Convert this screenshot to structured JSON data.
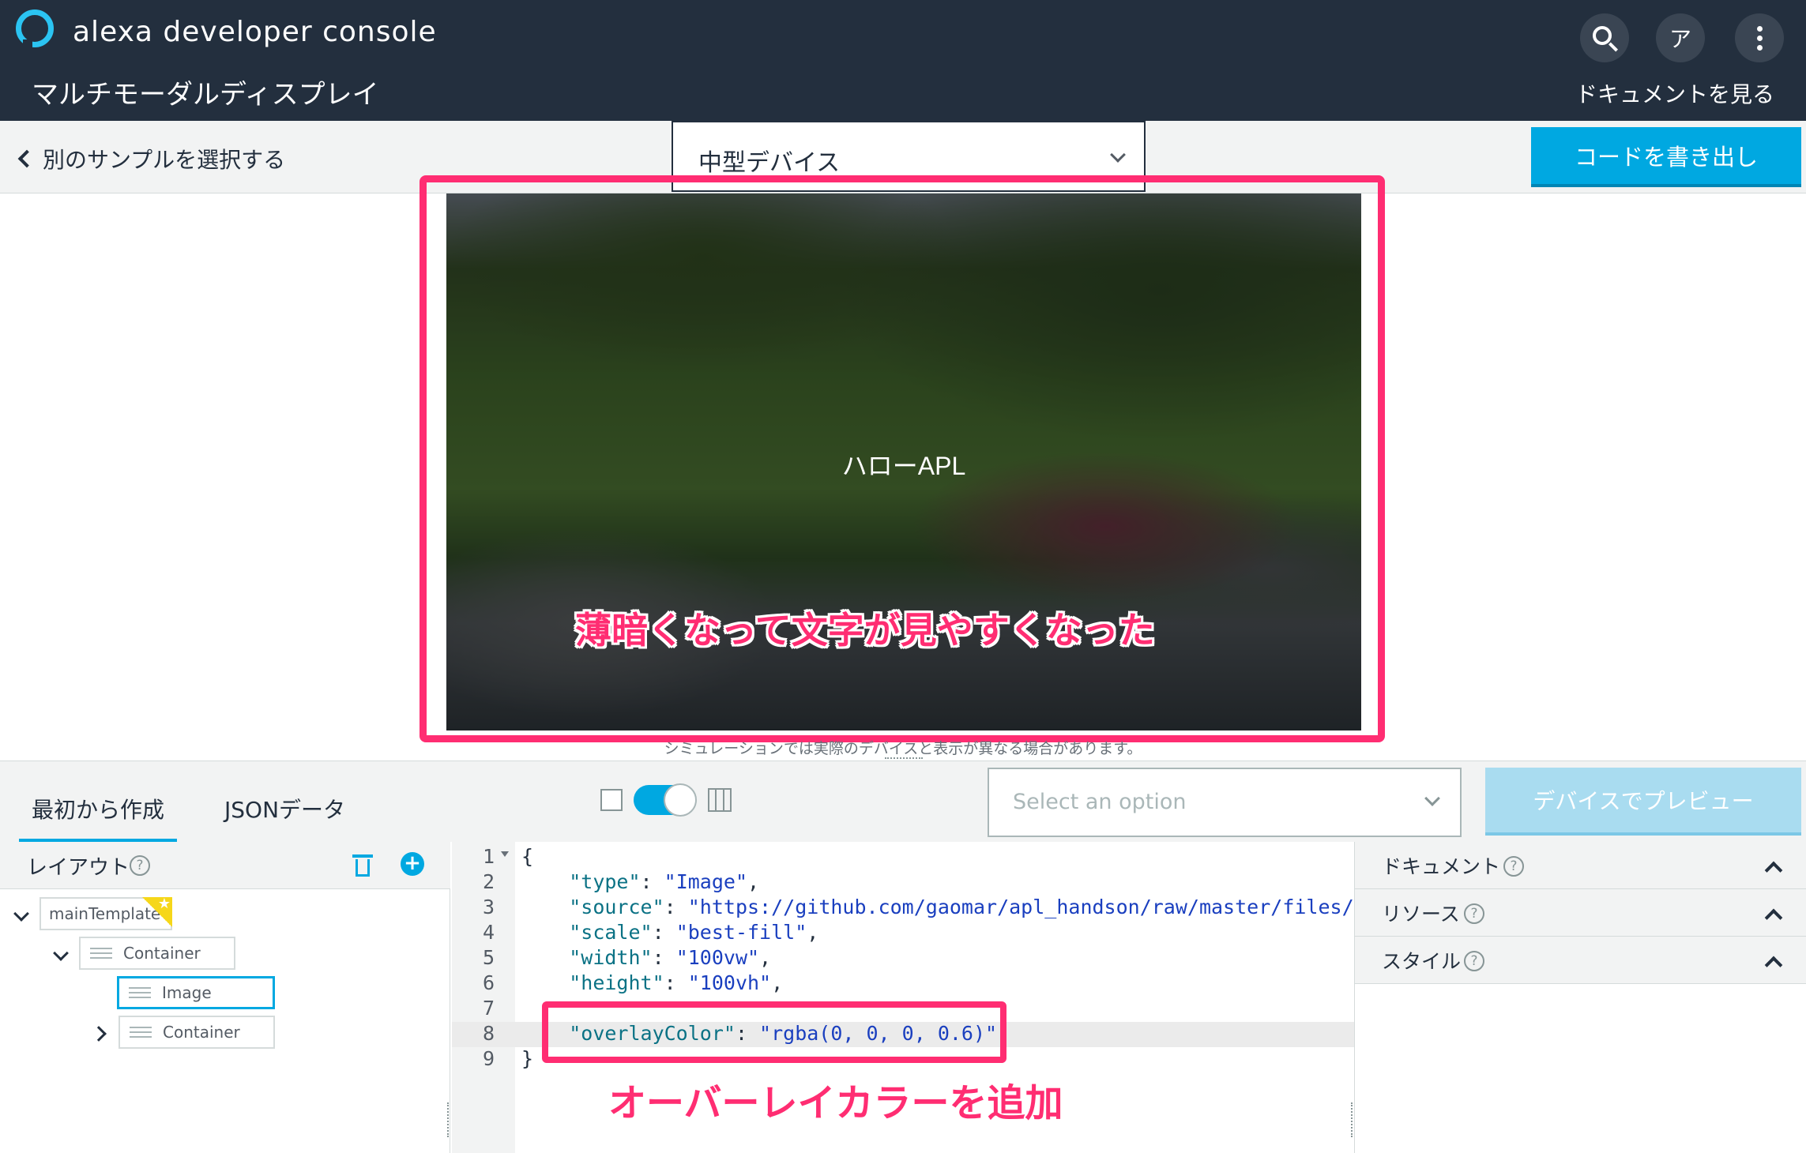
{
  "header": {
    "brand": "alexa developer console",
    "app_title": "マルチモーダルディスプレイ",
    "docs_link": "ドキュメントを見る",
    "avatar_initial": "ア"
  },
  "toolbar": {
    "back_label": "別のサンプルを選択する",
    "device_select": "中型デバイス",
    "export_label": "コードを書き出し"
  },
  "preview": {
    "hello_text": "ハローAPL",
    "callout": "薄暗くなって文字が見やすくなった",
    "sim_note": "シミュレーションでは実際のデバイスと表示が異なる場合があります。"
  },
  "editor_bar": {
    "tabs": [
      {
        "label": "最初から作成",
        "active": true
      },
      {
        "label": "JSONデータ",
        "active": false
      }
    ],
    "option_placeholder": "Select an option",
    "device_preview_label": "デバイスでプレビュー"
  },
  "layout_panel": {
    "title": "レイアウト",
    "help": "?",
    "add": "+",
    "tree": [
      {
        "label": "mainTemplate"
      },
      {
        "label": "Container"
      },
      {
        "label": "Image",
        "selected": true
      },
      {
        "label": "Container"
      }
    ]
  },
  "code": {
    "lines": [
      {
        "n": "1",
        "parts": [
          {
            "c": "p",
            "t": "{"
          }
        ]
      },
      {
        "n": "2",
        "parts": [
          {
            "c": "p",
            "t": "    "
          },
          {
            "c": "k",
            "t": "\"type\""
          },
          {
            "c": "p",
            "t": ": "
          },
          {
            "c": "s",
            "t": "\"Image\""
          },
          {
            "c": "p",
            "t": ","
          }
        ]
      },
      {
        "n": "3",
        "parts": [
          {
            "c": "p",
            "t": "    "
          },
          {
            "c": "k",
            "t": "\"source\""
          },
          {
            "c": "p",
            "t": ": "
          },
          {
            "c": "s",
            "t": "\"https://github.com/gaomar/apl_handson/raw/master/files/bac"
          }
        ]
      },
      {
        "n": "4",
        "parts": [
          {
            "c": "p",
            "t": "    "
          },
          {
            "c": "k",
            "t": "\"scale\""
          },
          {
            "c": "p",
            "t": ": "
          },
          {
            "c": "s",
            "t": "\"best-fill\""
          },
          {
            "c": "p",
            "t": ","
          }
        ]
      },
      {
        "n": "5",
        "parts": [
          {
            "c": "p",
            "t": "    "
          },
          {
            "c": "k",
            "t": "\"width\""
          },
          {
            "c": "p",
            "t": ": "
          },
          {
            "c": "s",
            "t": "\"100vw\""
          },
          {
            "c": "p",
            "t": ","
          }
        ]
      },
      {
        "n": "6",
        "parts": [
          {
            "c": "p",
            "t": "    "
          },
          {
            "c": "k",
            "t": "\"height\""
          },
          {
            "c": "p",
            "t": ": "
          },
          {
            "c": "s",
            "t": "\"100vh\""
          },
          {
            "c": "p",
            "t": ","
          }
        ]
      },
      {
        "n": "7",
        "parts": [
          {
            "c": "p",
            "t": ""
          }
        ]
      },
      {
        "n": "8",
        "parts": [
          {
            "c": "p",
            "t": "    "
          },
          {
            "c": "k",
            "t": "\"overlayColor\""
          },
          {
            "c": "p",
            "t": ": "
          },
          {
            "c": "s",
            "t": "\"rgba(0, 0, 0, 0.6)\""
          }
        ]
      },
      {
        "n": "9",
        "parts": [
          {
            "c": "p",
            "t": "}"
          }
        ]
      }
    ],
    "callout": "オーバーレイカラーを追加"
  },
  "side_panel": {
    "sections": [
      {
        "label": "ドキュメント",
        "help": "?"
      },
      {
        "label": "リソース",
        "help": "?"
      },
      {
        "label": "スタイル",
        "help": "?"
      }
    ]
  },
  "colors": {
    "header_bg": "#232f3e",
    "accent": "#00a8e1",
    "highlight": "#ff2d72"
  }
}
